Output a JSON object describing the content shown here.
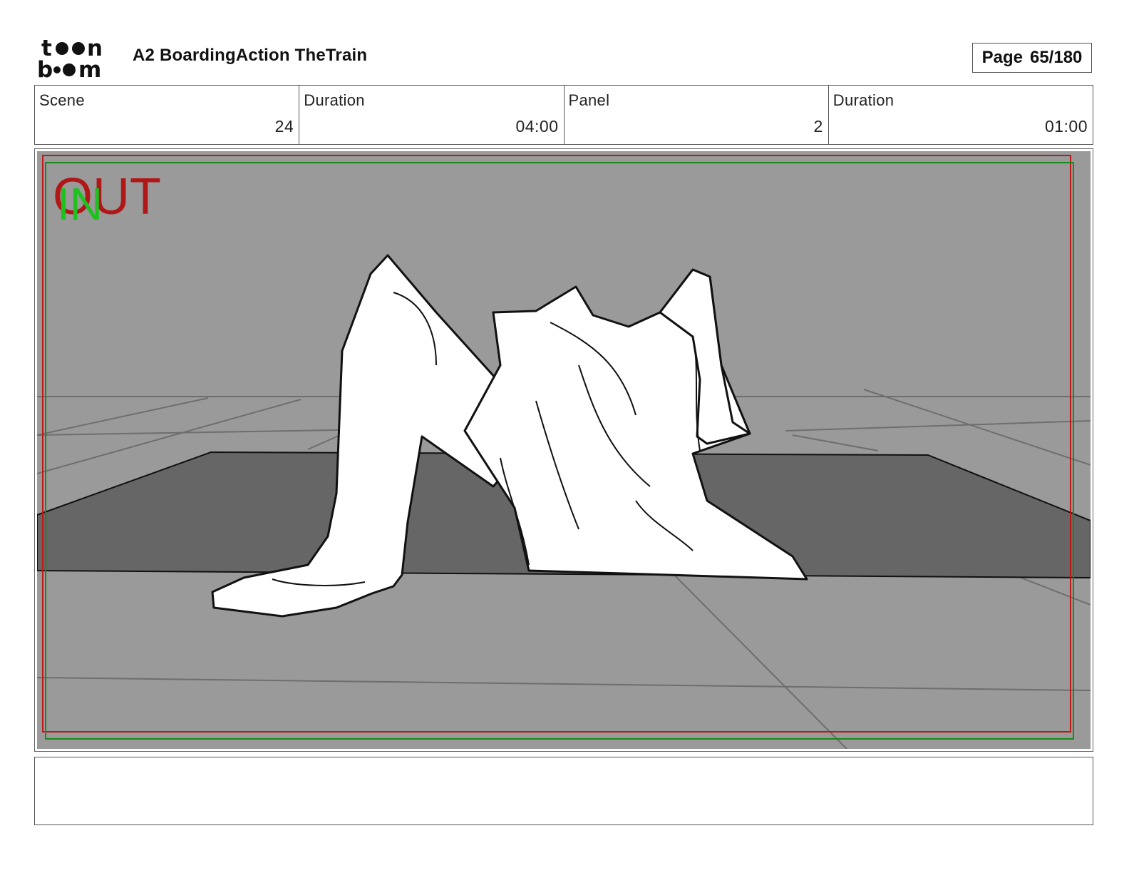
{
  "header": {
    "logo_text": "toon boom",
    "project_title": "A2 BoardingAction TheTrain",
    "page_label": "Page",
    "page_number": "65/180"
  },
  "info": [
    {
      "label": "Scene",
      "value": "24"
    },
    {
      "label": "Duration",
      "value": "04:00"
    },
    {
      "label": "Panel",
      "value": "2"
    },
    {
      "label": "Duration",
      "value": "01:00"
    }
  ],
  "panel": {
    "safe_area_out_label": "OUT",
    "safe_area_in_label": "IN",
    "colors": {
      "background": "#9a9a9a",
      "floor_dark": "#666666",
      "figure": "#ffffff",
      "out_frame": "#c01818",
      "in_frame": "#1a8a1a"
    }
  },
  "notes": {
    "text": ""
  }
}
